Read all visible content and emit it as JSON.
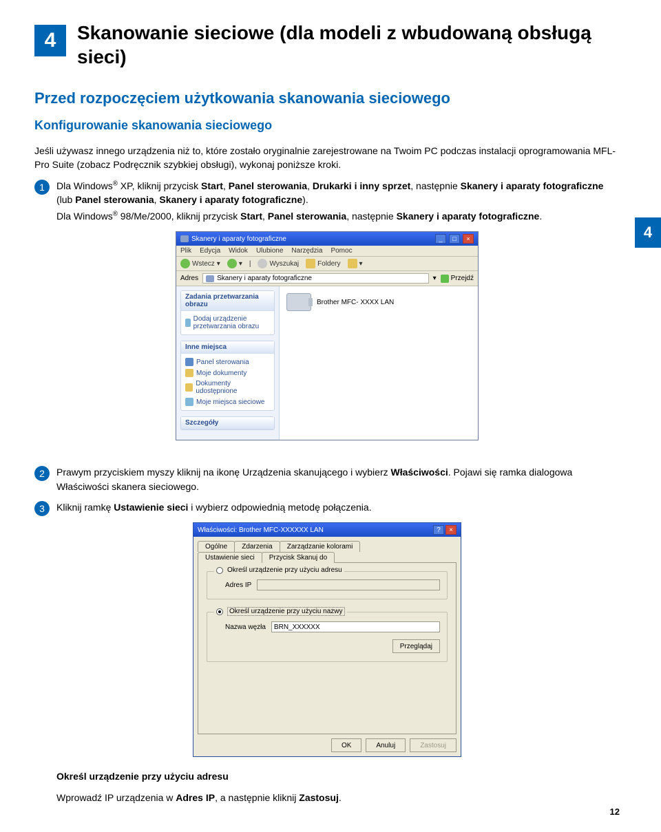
{
  "chapter": "4",
  "sideTab": "4",
  "pageNumber": "12",
  "title": "Skanowanie sieciowe (dla modeli z wbudowaną obsługą sieci)",
  "h2": "Przed rozpoczęciem użytkowania skanowania sieciowego",
  "h3": "Konfigurowanie skanowania sieciowego",
  "intro": "Jeśli używasz innego urządzenia niż to, które zostało oryginalnie zarejestrowane na Twoim PC podczas instalacji oprogramowania MFL-Pro Suite (zobacz Podręcznik szybkiej obsługi), wykonaj poniższe kroki.",
  "step1_a": "Dla Windows",
  "step1_b": " XP, kliknij przycisk ",
  "step1_start": "Start",
  "step1_c": ", ",
  "step1_panel": "Panel sterowania",
  "step1_d": ", ",
  "step1_druk": "Drukarki i inny sprzet",
  "step1_e": ", następnie ",
  "step1_skan": "Skanery i aparaty fotograficzne",
  "step1_f": " (lub ",
  "step1_panel2": "Panel sterowania",
  "step1_g": ", ",
  "step1_skan2": "Skanery i aparaty fotograficzne",
  "step1_h": ").",
  "step1p2_a": "Dla Windows",
  "step1p2_b": " 98/Me/2000, kliknij przycisk ",
  "step1p2_start": "Start",
  "step1p2_c": ", ",
  "step1p2_panel": "Panel sterowania",
  "step1p2_d": ", następnie ",
  "step1p2_skan": "Skanery i aparaty fotograficzne",
  "step1p2_e": ".",
  "step2_a": "Prawym przyciskiem myszy kliknij na ikonę Urządzenia skanującego i wybierz ",
  "step2_wlas": "Właściwości",
  "step2_b": ". Pojawi się ramka dialogowa Właściwości skanera sieciowego.",
  "step3_a": "Kliknij ramkę ",
  "step3_ust": "Ustawienie sieci",
  "step3_b": " i wybierz odpowiednią metodę połączenia.",
  "spec_head": "Określ urządzenie przy użyciu adresu",
  "spec_body_a": "Wprowadź IP urządzenia w ",
  "spec_adres": "Adres IP",
  "spec_body_b": ", a następnie kliknij ",
  "spec_zast": "Zastosuj",
  "spec_body_c": ".",
  "win1": {
    "title": "Skanery i aparaty fotograficzne",
    "menu": {
      "plik": "Plik",
      "edycja": "Edycja",
      "widok": "Widok",
      "ulub": "Ulubione",
      "narz": "Narzędzia",
      "pomoc": "Pomoc"
    },
    "tool": {
      "wstecz": "Wstecz",
      "wyszukaj": "Wyszukaj",
      "foldery": "Foldery"
    },
    "addr_label": "Adres",
    "addr_value": "Skanery i aparaty fotograficzne",
    "go": "Przejdź",
    "task_head": "Zadania przetwarzania obrazu",
    "task_item": "Dodaj urządzenie przetwarzania obrazu",
    "places_head": "Inne miejsca",
    "places": {
      "a": "Panel sterowania",
      "b": "Moje dokumenty",
      "c": "Dokumenty udostępnione",
      "d": "Moje miejsca sieciowe"
    },
    "details_head": "Szczegóły",
    "device": "Brother MFC- XXXX LAN"
  },
  "dlg": {
    "title": "Właściwości: Brother MFC-XXXXXX LAN",
    "tabs": {
      "ogolne": "Ogólne",
      "zdarz": "Zdarzenia",
      "kolor": "Zarządzanie kolorami",
      "siec": "Ustawienie sieci",
      "skan": "Przycisk Skanuj do"
    },
    "r1_label": "Określ urządzenie przy użyciu adresu",
    "r1_field": "Adres IP",
    "r2_label": "Określ urządzenie przy użyciu nazwy",
    "r2_field": "Nazwa węzła",
    "r2_value": "BRN_XXXXXX",
    "browse": "Przeglądaj",
    "ok": "OK",
    "anuluj": "Anuluj",
    "zastosuj": "Zastosuj"
  }
}
